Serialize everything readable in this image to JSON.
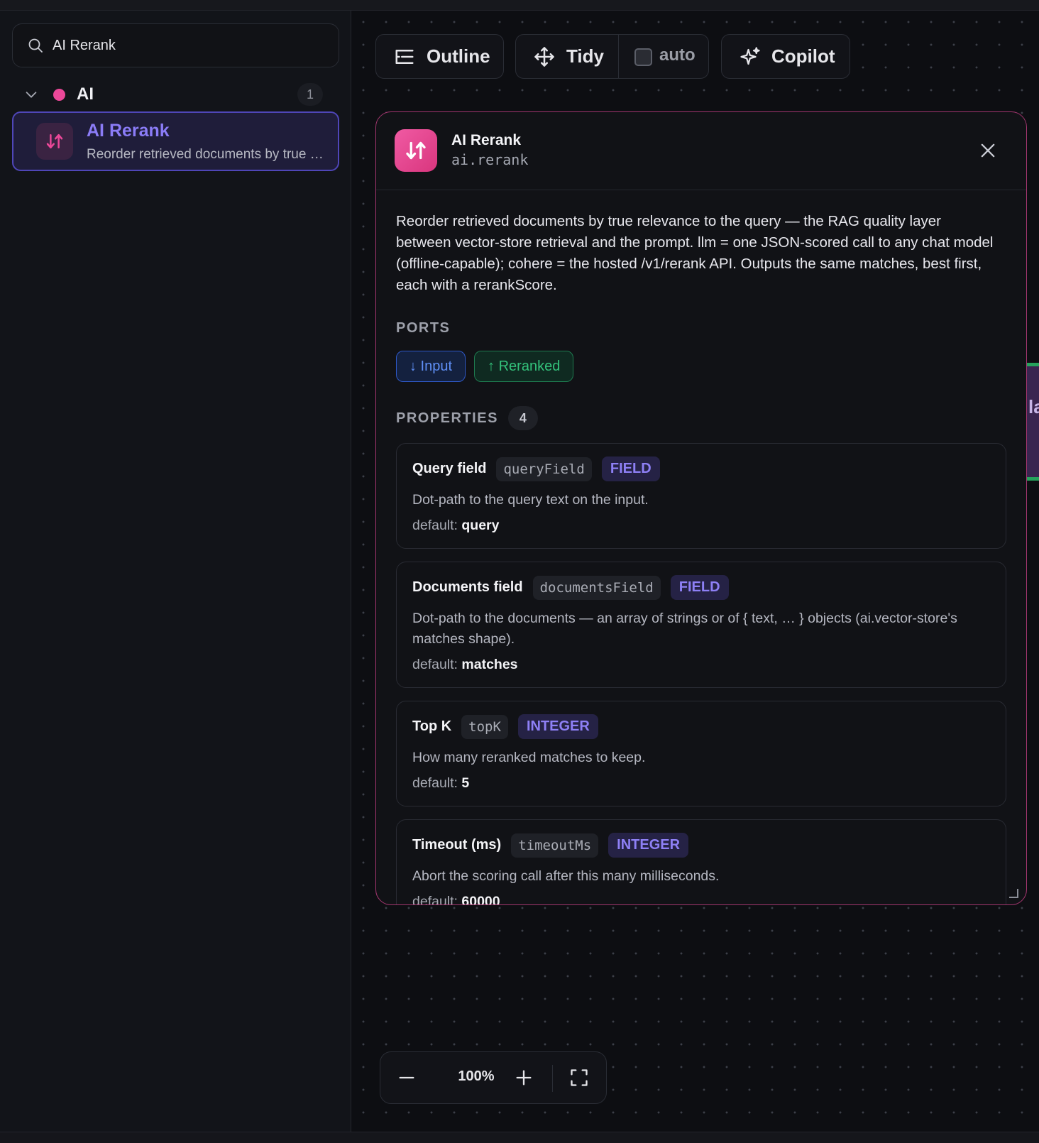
{
  "sidebar": {
    "search": {
      "value": "AI Rerank",
      "icon": "search-icon"
    },
    "group": {
      "name": "AI",
      "count": "1",
      "dot_color": "#ec4899"
    },
    "node": {
      "title": "AI Rerank",
      "description": "Reorder retrieved documents by true relevance to the query — the RAG quality layer between vector-store retrieval and the prompt."
    }
  },
  "toolbar": {
    "outline": "Outline",
    "tidy": "Tidy",
    "auto": "auto",
    "copilot": "Copilot"
  },
  "panel": {
    "title": "AI Rerank",
    "id": "ai.rerank",
    "description": "Reorder retrieved documents by true relevance to the query — the RAG quality layer between vector-store retrieval and the prompt. llm = one JSON-scored call to any chat model (offline-capable); cohere = the hosted /v1/rerank API. Outputs the same matches, best first, each with a rerankScore.",
    "ports_label": "PORTS",
    "ports": [
      {
        "label": "↓ Input",
        "color": "#5f8ff6"
      },
      {
        "label": "↑ Reranked",
        "color": "#33c27b"
      }
    ],
    "properties_label": "PROPERTIES",
    "properties_count": "4",
    "default_label": "default:",
    "properties": [
      {
        "name": "Query field",
        "key": "queryField",
        "type": "FIELD",
        "description": "Dot-path to the query text on the input.",
        "default": "query"
      },
      {
        "name": "Documents field",
        "key": "documentsField",
        "type": "FIELD",
        "description": "Dot-path to the documents — an array of strings or of { text, … } objects (ai.vector-store's matches shape).",
        "default": "matches"
      },
      {
        "name": "Top K",
        "key": "topK",
        "type": "INTEGER",
        "description": "How many reranked matches to keep.",
        "default": "5"
      },
      {
        "name": "Timeout (ms)",
        "key": "timeoutMs",
        "type": "INTEGER",
        "description": "Abort the scoring call after this many milliseconds.",
        "default": "60000"
      }
    ]
  },
  "side_peek": {
    "text": "la"
  },
  "zoom": {
    "level": "100%"
  },
  "colors": {
    "accent": "#8b7cf7",
    "pink": "#ec4899",
    "panel_border": "#a3366f"
  }
}
